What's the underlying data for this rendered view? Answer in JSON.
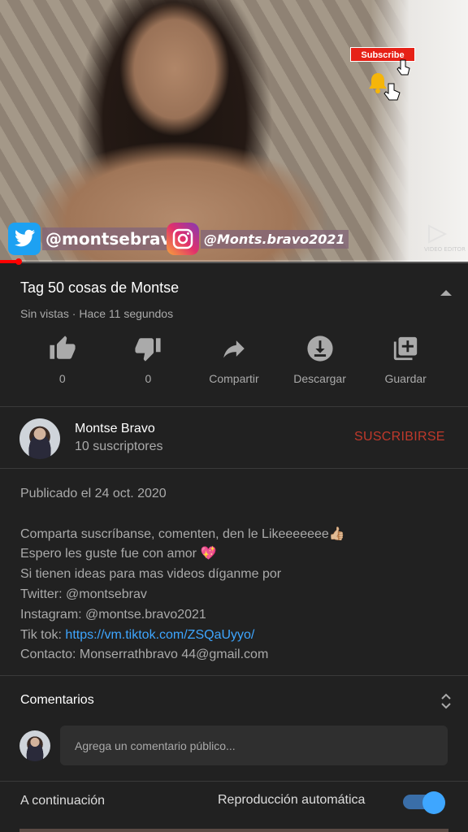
{
  "video": {
    "overlay_subscribe": "Subscribe",
    "twitter_handle": "@montsebrav",
    "instagram_handle": "@Monts.bravo2021",
    "watermark": "VIDEO EDITOR",
    "progress_fraction": 0.04
  },
  "info": {
    "title": "Tag 50 cosas de Montse",
    "meta": "Sin vistas · Hace 11 segundos"
  },
  "actions": [
    {
      "icon": "thumbs-up-icon",
      "label": "0"
    },
    {
      "icon": "thumbs-down-icon",
      "label": "0"
    },
    {
      "icon": "share-icon",
      "label": "Compartir"
    },
    {
      "icon": "download-icon",
      "label": "Descargar"
    },
    {
      "icon": "add-to-playlist-icon",
      "label": "Guardar"
    }
  ],
  "channel": {
    "name": "Montse Bravo",
    "subscribers": "10 suscriptores",
    "subscribe_label": "SUSCRIBIRSE"
  },
  "description": {
    "published": "Publicado el 24 oct. 2020",
    "lines": [
      "Comparta suscríbanse, comenten, den le Likeeeeeee👍🏼",
      "Espero les guste fue con amor 💖",
      "Si tienen ideas para mas videos díganme por",
      "Twitter: @montsebrav",
      "Instagram: @montse.bravo2021"
    ],
    "tiktok_prefix": "Tik tok: ",
    "tiktok_link": "https://vm.tiktok.com/ZSQaUyyo/",
    "contact": "Contacto: Monserrathbravo 44@gmail.com"
  },
  "comments": {
    "title": "Comentarios",
    "placeholder": "Agrega un comentario público..."
  },
  "upnext": {
    "label": "A continuación",
    "autoplay_label": "Reproducción automática",
    "autoplay_on": true
  },
  "colors": {
    "background": "#212121",
    "subscribe": "#c0392b",
    "link": "#3ea6ff",
    "progress": "#ff0000"
  }
}
